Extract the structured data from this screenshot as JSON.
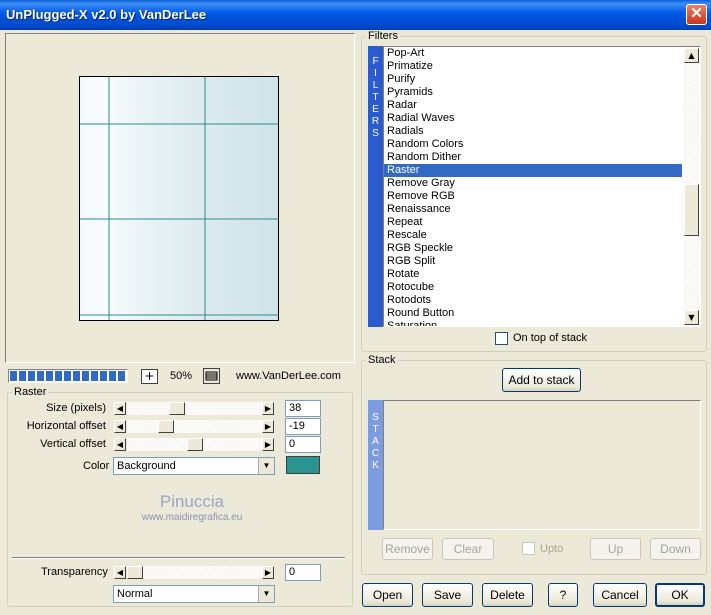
{
  "window": {
    "title": "UnPlugged-X v2.0 by VanDerLee",
    "close_glyph": "✕"
  },
  "preview": {
    "zoom": "50%",
    "zoom_in_glyph": "+",
    "website": "www.VanDerLee.com",
    "progress_blocks": 13
  },
  "raster": {
    "group_label": "Raster",
    "params": [
      {
        "label": "Size (pixels)",
        "value": "38",
        "position": 0.35
      },
      {
        "label": "Horizontal offset",
        "value": "-19",
        "position": 0.26
      },
      {
        "label": "Vertical offset",
        "value": "0",
        "position": 0.5
      }
    ],
    "color_label": "Color",
    "color_option": "Background",
    "color_swatch": "#2b9490",
    "watermark_title": "Pinuccia",
    "watermark_url": "www.maidiregrafica.eu",
    "transparency_label": "Transparency",
    "transparency_value": "0",
    "transparency_position": 0.0,
    "blend_mode": "Normal"
  },
  "filters": {
    "group_label": "Filters",
    "side_label": [
      "F",
      "I",
      "L",
      "T",
      "E",
      "R",
      "S"
    ],
    "items": [
      "Pop-Art",
      "Primatize",
      "Purify",
      "Pyramids",
      "Radar",
      "Radial Waves",
      "Radials",
      "Random Colors",
      "Random Dither",
      "Raster",
      "Remove Gray",
      "Remove RGB",
      "Renaissance",
      "Repeat",
      "Rescale",
      "RGB Speckle",
      "RGB Split",
      "Rotate",
      "Rotocube",
      "Rotodots",
      "Round Button",
      "Saturation"
    ],
    "selected": "Raster",
    "on_top_label": "On top of stack",
    "up_glyph": "▲",
    "down_glyph": "▼"
  },
  "stack": {
    "group_label": "Stack",
    "add_label": "Add to stack",
    "side_label": [
      "S",
      "T",
      "A",
      "C",
      "K"
    ],
    "remove_label": "Remove",
    "clear_label": "Clear",
    "upto_label": "Upto",
    "up_label": "Up",
    "down_label": "Down"
  },
  "bottom": {
    "open": "Open",
    "save": "Save",
    "delete": "Delete",
    "help": "?",
    "cancel": "Cancel",
    "ok": "OK"
  },
  "glyphs": {
    "left": "◀",
    "right": "▶",
    "down": "▼"
  }
}
